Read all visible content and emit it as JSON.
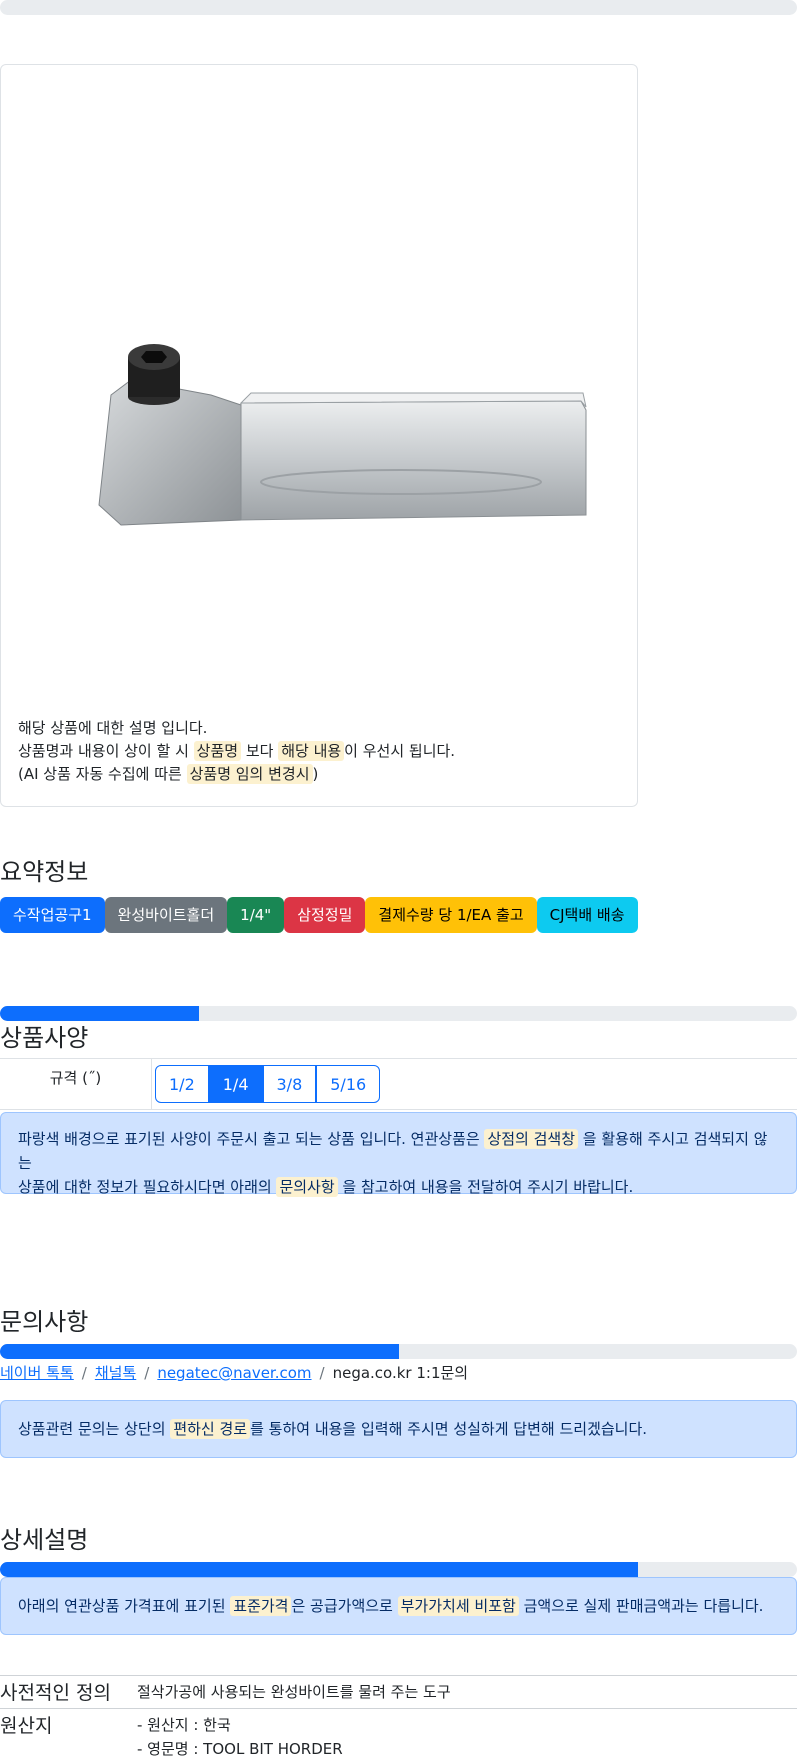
{
  "image_card": {
    "note_line1": "해당 상품에 대한 설명 입니다.",
    "note_line2_a": "상품명과 내용이 상이 할 시 ",
    "note_line2_mark1": "상품명",
    "note_line2_b": " 보다 ",
    "note_line2_mark2": "해당 내용",
    "note_line2_c": "이 우선시 됩니다.",
    "note_line3_a": "(AI 상품 자동 수집에 따른 ",
    "note_line3_mark": "상품명 임의 변경시",
    "note_line3_b": ")",
    "product_image": "tool-bit-holder-photo"
  },
  "summary": {
    "title": "요약정보",
    "badges": [
      {
        "label": "수작업공구1",
        "color": "#0d6efd",
        "text": "#ffffff"
      },
      {
        "label": "완성바이트홀더",
        "color": "#6c757d",
        "text": "#ffffff"
      },
      {
        "label": "1/4\"",
        "color": "#198754",
        "text": "#ffffff"
      },
      {
        "label": "삼정정밀",
        "color": "#dc3545",
        "text": "#ffffff"
      },
      {
        "label": "결제수량 당 1/EA 출고",
        "color": "#ffc107",
        "text": "#000000"
      },
      {
        "label": "CJ택배 배송",
        "color": "#0dcaf0",
        "text": "#000000"
      }
    ]
  },
  "specs": {
    "progress": 0.25,
    "title": "상품사양",
    "label": "규격 (˝)",
    "options": [
      "1/2",
      "1/4",
      "3/8",
      "5/16"
    ],
    "selected": "1/4",
    "alert_a": "파랑색 배경으로 표기된 사양이 주문시 출고 되는 상품 입니다. 연관상품은 ",
    "alert_mark1": "상점의 검색창",
    "alert_b": " 을 활용해 주시고 검색되지 않는",
    "alert_c": "상품에 대한 정보가 필요하시다면 아래의 ",
    "alert_mark2": "문의사항",
    "alert_d": " 을 참고하여 내용을 전달하여 주시기 바랍니다."
  },
  "inquiry": {
    "title": "문의사항",
    "progress": 0.5,
    "links": [
      "네이버 톡톡",
      "채널톡",
      "negatec@naver.com"
    ],
    "plain": "nega.co.kr 1:1문의",
    "alert_a": "상품관련 문의는 상단의 ",
    "alert_mark": "편하신 경로",
    "alert_b": "를 통하여 내용을 입력해 주시면 성실하게 답변해 드리겠습니다."
  },
  "detail": {
    "title": "상세설명",
    "progress": 0.8,
    "alert_a": "아래의 연관상품 가격표에 표기된 ",
    "alert_mark1": "표준가격",
    "alert_b": "은 공급가액으로 ",
    "alert_mark2": "부가가치세 비포함",
    "alert_c": " 금액으로 실제 판매금액과는 다릅니다.",
    "rows": [
      {
        "key": "사전적인 정의",
        "values": [
          "절삭가공에 사용되는 완성바이트를 물려 주는 도구"
        ]
      },
      {
        "key": "원산지",
        "values": [
          "- 원산지 : 한국",
          "- 영문명 : TOOL BIT HORDER"
        ]
      }
    ]
  },
  "top_progress": 0.0
}
